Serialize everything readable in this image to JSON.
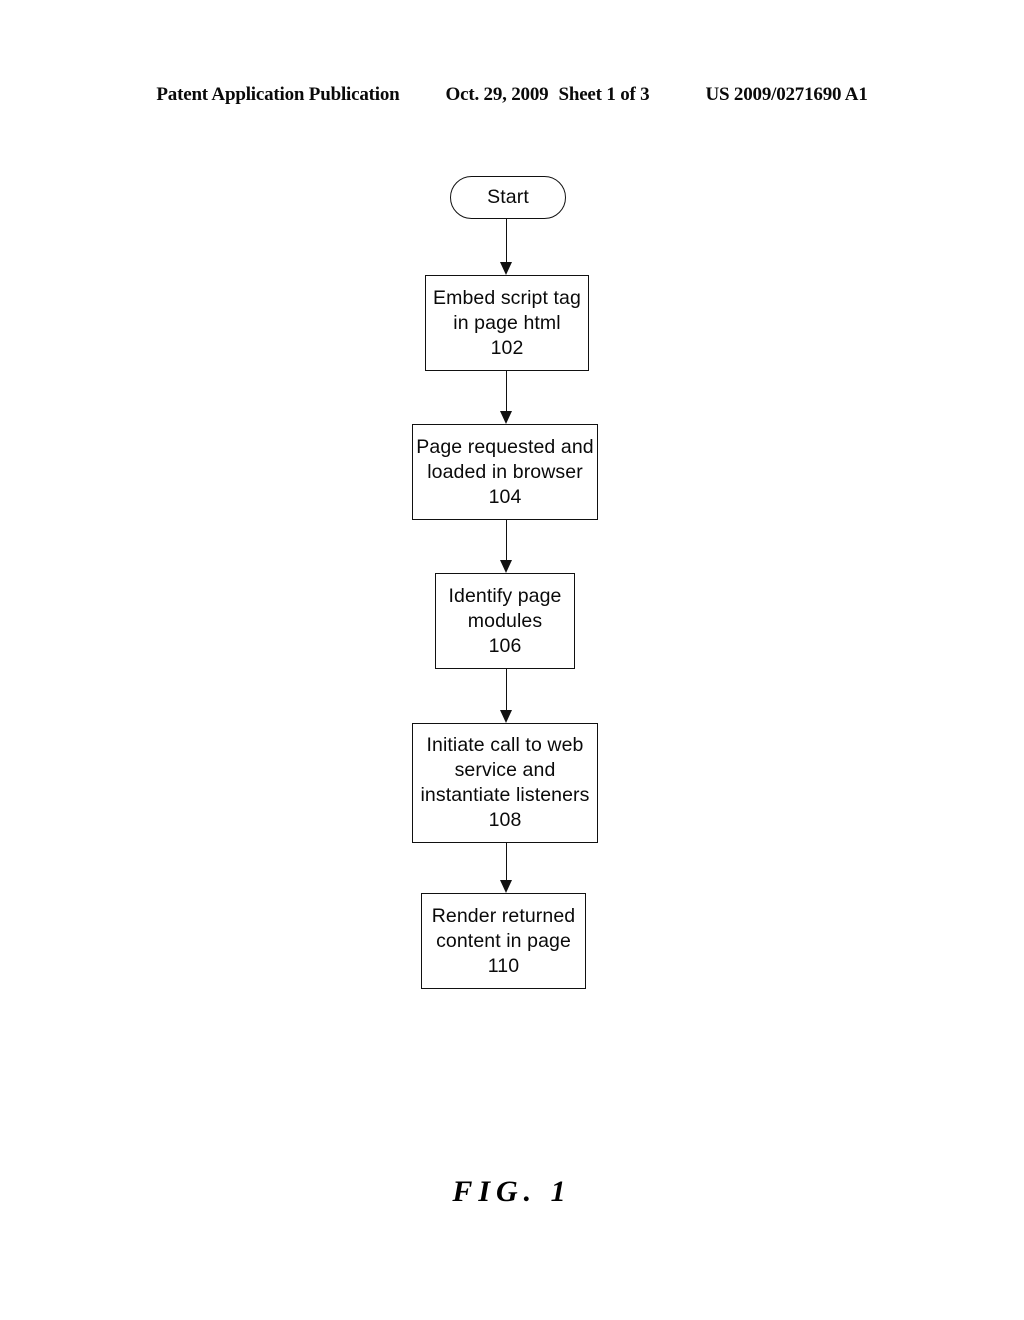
{
  "header": {
    "publication": "Patent Application Publication",
    "date": "Oct. 29, 2009",
    "sheet": "Sheet 1 of 3",
    "patent_number": "US 2009/0271690 A1"
  },
  "figure": {
    "caption": "FIG. 1"
  },
  "flowchart": {
    "nodes": [
      {
        "id": "start",
        "shape": "terminal",
        "label": "Start",
        "lines": [
          "Start"
        ],
        "ref": ""
      },
      {
        "id": "102",
        "shape": "process",
        "label": "Embed script tag in page html",
        "lines": [
          "Embed script tag",
          "in page html"
        ],
        "ref": "102"
      },
      {
        "id": "104",
        "shape": "process",
        "label": "Page requested and loaded in browser",
        "lines": [
          "Page requested and",
          "loaded in browser"
        ],
        "ref": "104"
      },
      {
        "id": "106",
        "shape": "process",
        "label": "Identify page modules",
        "lines": [
          "Identify page",
          "modules"
        ],
        "ref": "106"
      },
      {
        "id": "108",
        "shape": "process",
        "label": "Initiate call to web service and instantiate listeners",
        "lines": [
          "Initiate call to web",
          "service and",
          "instantiate listeners"
        ],
        "ref": "108"
      },
      {
        "id": "110",
        "shape": "process",
        "label": "Render returned content in page",
        "lines": [
          "Render returned",
          "content in page"
        ],
        "ref": "110"
      }
    ],
    "edges": [
      {
        "from": "start",
        "to": "102"
      },
      {
        "from": "102",
        "to": "104"
      },
      {
        "from": "104",
        "to": "106"
      },
      {
        "from": "106",
        "to": "108"
      },
      {
        "from": "108",
        "to": "110"
      }
    ],
    "colors": {
      "stroke": "#111111",
      "fill": "#ffffff",
      "text": "#0a0a0a"
    }
  }
}
